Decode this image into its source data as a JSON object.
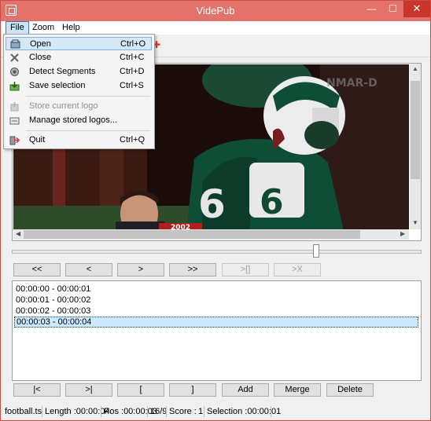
{
  "window": {
    "title": "VidePub",
    "min_glyph": "—",
    "max_glyph": "☐",
    "close_glyph": "✕"
  },
  "menubar": {
    "items": [
      {
        "label": "File"
      },
      {
        "label": "Zoom"
      },
      {
        "label": "Help"
      }
    ]
  },
  "file_menu": {
    "items": [
      {
        "label": "Open",
        "shortcut": "Ctrl+O",
        "icon": "open-icon"
      },
      {
        "label": "Close",
        "shortcut": "Ctrl+C",
        "icon": "close-icon"
      },
      {
        "label": "Detect Segments",
        "shortcut": "Ctrl+D",
        "icon": "detect-icon"
      },
      {
        "label": "Save selection",
        "shortcut": "Ctrl+S",
        "icon": "save-icon"
      },
      {
        "label": "Store current logo",
        "shortcut": "",
        "icon": "store-logo-icon"
      },
      {
        "label": "Manage stored logos...",
        "shortcut": "",
        "icon": "manage-logos-icon"
      },
      {
        "label": "Quit",
        "shortcut": "Ctrl+Q",
        "icon": "quit-icon"
      }
    ]
  },
  "video": {
    "overlay_text": "2002",
    "watermark_text": "NMAR-D"
  },
  "navigation": {
    "buttons": [
      "<<",
      "<",
      ">",
      ">>",
      ">[]",
      ">X"
    ]
  },
  "segments": [
    "00:00:00 - 00:00:01",
    "00:00:01 - 00:00:02",
    "00:00:02 - 00:00:03",
    "00:00:03 - 00:00:04"
  ],
  "actions": {
    "buttons": [
      "|<",
      ">|",
      "[",
      "]",
      "Add",
      "Merge",
      "Delete"
    ]
  },
  "status": {
    "file": "football.ts",
    "length": "Length :00:00:04",
    "pos": "Pos :00:00:03",
    "aspect": "16/9",
    "score": "Score :",
    "score_value": "1",
    "selection": "Selection :00:00:01"
  },
  "colors": {
    "titlebar": "#e2726a",
    "close_button": "#c7352b",
    "menu_hover": "#d5e8f7",
    "selection": "#cce8ff"
  }
}
